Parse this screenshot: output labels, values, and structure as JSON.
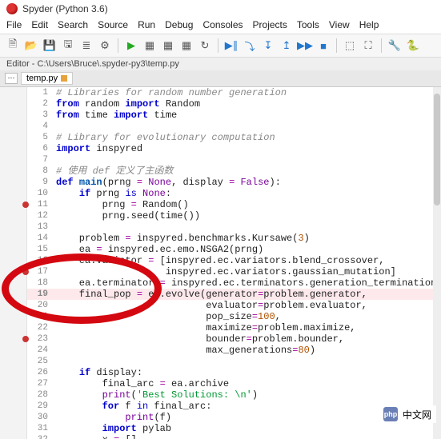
{
  "window": {
    "title": "Spyder (Python 3.6)"
  },
  "menu": [
    "File",
    "Edit",
    "Search",
    "Source",
    "Run",
    "Debug",
    "Consoles",
    "Projects",
    "Tools",
    "View",
    "Help"
  ],
  "path": {
    "label": "Editor",
    "value": "C:\\Users\\Bruce\\.spyder-py3\\temp.py"
  },
  "tab": {
    "name": "temp.py"
  },
  "breakpoints": [
    11,
    17,
    23
  ],
  "current_line": 19,
  "code": [
    {
      "n": 1,
      "t": "comment",
      "text": "# Libraries for random number generation"
    },
    {
      "n": 2,
      "t": "plain",
      "html": "<span class='kw'>from</span> random <span class='kw'>import</span> Random"
    },
    {
      "n": 3,
      "t": "plain",
      "html": "<span class='kw'>from</span> time <span class='kw'>import</span> time"
    },
    {
      "n": 4,
      "t": "plain",
      "html": ""
    },
    {
      "n": 5,
      "t": "comment",
      "text": "# Library for evolutionary computation"
    },
    {
      "n": 6,
      "t": "plain",
      "html": "<span class='kw'>import</span> inspyred"
    },
    {
      "n": 7,
      "t": "plain",
      "html": ""
    },
    {
      "n": 8,
      "t": "comment",
      "text": "# 使用 def 定义了主函数"
    },
    {
      "n": 9,
      "t": "plain",
      "html": "<span class='kw'>def</span> <span class='fn'>main</span>(prng <span class='op'>=</span> <span class='bi'>None</span>, display <span class='op'>=</span> <span class='bi'>False</span>):"
    },
    {
      "n": 10,
      "t": "plain",
      "html": "    <span class='kw'>if</span> prng <span class='kw2'>is</span> <span class='bi'>None</span>:"
    },
    {
      "n": 11,
      "t": "plain",
      "html": "        prng <span class='op'>=</span> Random()"
    },
    {
      "n": 12,
      "t": "plain",
      "html": "        prng.seed(time())"
    },
    {
      "n": 13,
      "t": "plain",
      "html": ""
    },
    {
      "n": 14,
      "t": "plain",
      "html": "    problem <span class='op'>=</span> inspyred.benchmarks.Kursawe(<span class='num'>3</span>)"
    },
    {
      "n": 15,
      "t": "plain",
      "html": "    ea <span class='op'>=</span> inspyred.ec.emo.NSGA2(prng)"
    },
    {
      "n": 16,
      "t": "plain",
      "html": "    ea.variator <span class='op'>=</span> [inspyred.ec.variators.blend_crossover,"
    },
    {
      "n": 17,
      "t": "plain",
      "html": "                   inspyred.ec.variators.gaussian_mutation]"
    },
    {
      "n": 18,
      "t": "plain",
      "html": "    ea.terminator <span class='op'>=</span> inspyred.ec.terminators.generation_termination"
    },
    {
      "n": 19,
      "t": "plain",
      "html": "    final_pop <span class='op'>=</span> ea.evolve(generator<span class='op'>=</span>problem.generator,"
    },
    {
      "n": 20,
      "t": "plain",
      "html": "                          evaluator<span class='op'>=</span>problem.evaluator,"
    },
    {
      "n": 21,
      "t": "plain",
      "html": "                          pop_size<span class='op'>=</span><span class='num'>100</span>,"
    },
    {
      "n": 22,
      "t": "plain",
      "html": "                          maximize<span class='op'>=</span>problem.maximize,"
    },
    {
      "n": 23,
      "t": "plain",
      "html": "                          bounder<span class='op'>=</span>problem.bounder,"
    },
    {
      "n": 24,
      "t": "plain",
      "html": "                          max_generations<span class='op'>=</span><span class='num'>80</span>)"
    },
    {
      "n": 25,
      "t": "plain",
      "html": ""
    },
    {
      "n": 26,
      "t": "plain",
      "html": "    <span class='kw'>if</span> display:"
    },
    {
      "n": 27,
      "t": "plain",
      "html": "        final_arc <span class='op'>=</span> ea.archive"
    },
    {
      "n": 28,
      "t": "plain",
      "html": "        <span class='bi'>print</span>(<span class='str'>'Best Solutions: \\n'</span>)"
    },
    {
      "n": 29,
      "t": "plain",
      "html": "        <span class='kw'>for</span> f <span class='kw2'>in</span> final_arc:"
    },
    {
      "n": 30,
      "t": "plain",
      "html": "            <span class='bi'>print</span>(f)"
    },
    {
      "n": 31,
      "t": "plain",
      "html": "        <span class='kw'>import</span> pylab"
    },
    {
      "n": 32,
      "t": "plain",
      "html": "        x <span class='op'>=</span> []"
    }
  ],
  "watermark": {
    "logo": "php",
    "text": "中文网"
  }
}
